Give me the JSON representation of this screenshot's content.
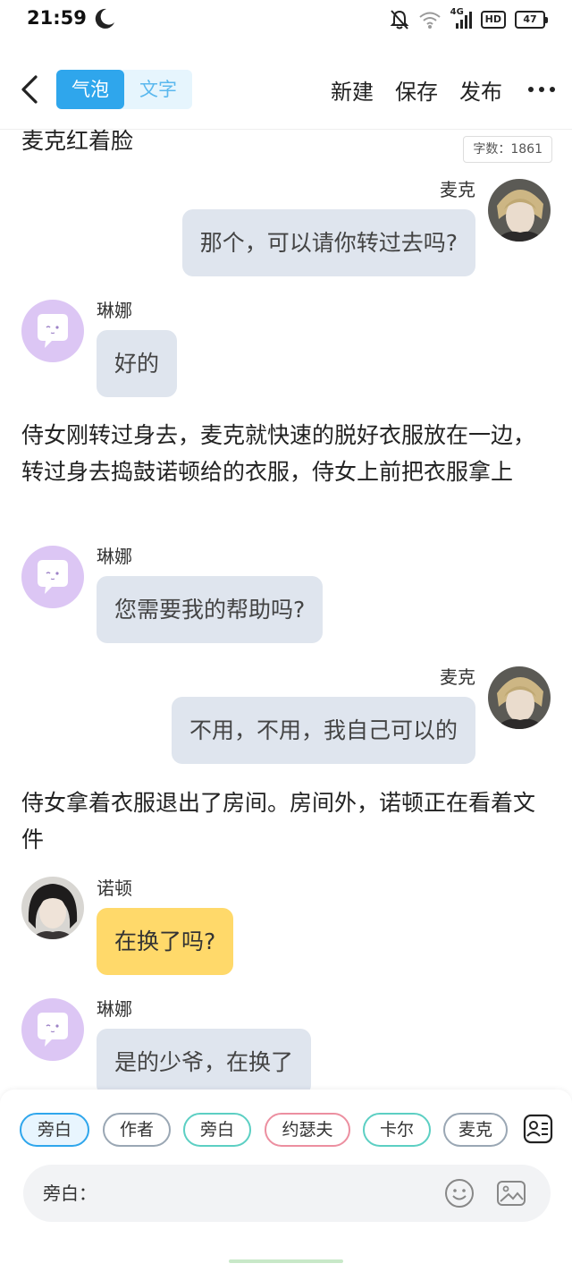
{
  "status_bar": {
    "time": "21:59",
    "network": "4G",
    "hd": "HD",
    "battery": "47",
    "icons": [
      "moon-icon",
      "mute-bell-icon",
      "wifi-icon",
      "signal-icon",
      "battery-icon"
    ]
  },
  "app_bar": {
    "mode_tabs": [
      {
        "label": "气泡",
        "active": true
      },
      {
        "label": "文字",
        "active": false
      }
    ],
    "actions": {
      "new": "新建",
      "save": "保存",
      "publish": "发布"
    }
  },
  "word_count": "字数：1861",
  "story": {
    "narration_top": "麦克红着脸",
    "messages": [
      {
        "speaker": "麦克",
        "side": "right",
        "text": "那个，可以请你转过去吗?"
      },
      {
        "speaker": "琳娜",
        "side": "left",
        "text": "好的"
      },
      {
        "narration": "侍女刚转过身去，麦克就快速的脱好衣服放在一边，转过身去捣鼓诺顿给的衣服，侍女上前把衣服拿上"
      },
      {
        "speaker": "琳娜",
        "side": "left",
        "text": "您需要我的帮助吗?"
      },
      {
        "speaker": "麦克",
        "side": "right",
        "text": "不用，不用，我自己可以的"
      },
      {
        "narration": "侍女拿着衣服退出了房间。房间外，诺顿正在看着文件"
      },
      {
        "speaker": "诺顿",
        "side": "left",
        "text": "在换了吗?"
      },
      {
        "speaker": "琳娜",
        "side": "left",
        "text": "是的少爷，在换了"
      }
    ]
  },
  "colors": {
    "accent": "#2fa6ec",
    "bubble_gray": "#dfe5ee",
    "bubble_yellow": "#ffd96a",
    "avatar_purple": "#dcc6f4"
  },
  "role_chips": [
    {
      "label": "旁白",
      "color": "#2fa6ec",
      "selected": true
    },
    {
      "label": "作者",
      "color": "#9aa7b4",
      "selected": false
    },
    {
      "label": "旁白",
      "color": "#5ccfc3",
      "selected": false
    },
    {
      "label": "约瑟夫",
      "color": "#ec8fa0",
      "selected": false
    },
    {
      "label": "卡尔",
      "color": "#5ccfc3",
      "selected": false
    },
    {
      "label": "麦克",
      "color": "#9aa7b4",
      "selected": false
    }
  ],
  "input": {
    "label": "旁白："
  }
}
